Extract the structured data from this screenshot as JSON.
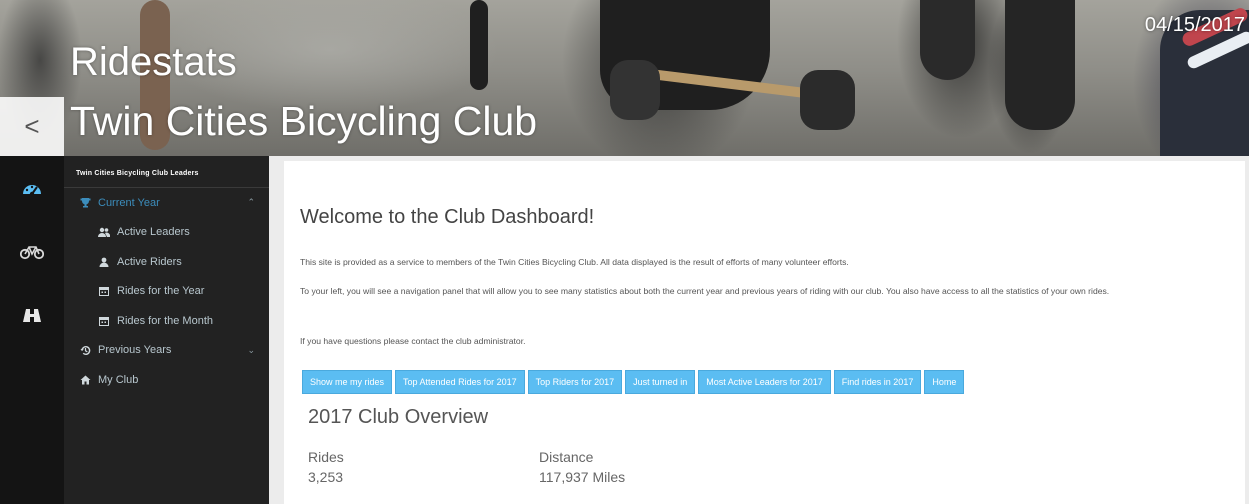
{
  "header": {
    "title_line1": "Ridestats",
    "title_line2": "Twin Cities Bicycling Club",
    "date": "04/15/2017",
    "back_symbol": "<"
  },
  "rail": {
    "items": [
      {
        "icon": "dashboard-icon"
      },
      {
        "icon": "bicycle-icon"
      },
      {
        "icon": "binoculars-icon"
      }
    ]
  },
  "sidebar": {
    "header": "Twin Cities Bicycling Club Leaders",
    "current_year": "Current Year",
    "active_leaders": "Active Leaders",
    "active_riders": "Active Riders",
    "rides_for_year": "Rides for the Year",
    "rides_for_month": "Rides for the Month",
    "previous_years": "Previous Years",
    "my_club": "My Club"
  },
  "main": {
    "welcome": "Welcome to the Club Dashboard!",
    "para1": "This site is provided as a service to members of the Twin Cities Bicycling Club. All data displayed is the result of efforts of many volunteer efforts.",
    "para2": "To your left, you will see a navigation panel that will allow you to see many statistics about both the current year and previous years of riding with our club. You also have access to all the statistics of your own rides.",
    "para3": "If you have questions please contact the club administrator.",
    "buttons": [
      "Show me my rides",
      "Top Attended Rides for 2017",
      "Top Riders for 2017",
      "Just turned in",
      "Most Active Leaders for 2017",
      "Find rides in 2017",
      "Home"
    ],
    "overview_title": "2017 Club Overview",
    "rides_label": "Rides",
    "rides_value": "3,253",
    "distance_label": "Distance",
    "distance_value": "117,937 Miles"
  },
  "colors": {
    "accent": "#3c8dbc",
    "button": "#5bbdf2",
    "sidebar": "#222222",
    "rail": "#141414"
  }
}
